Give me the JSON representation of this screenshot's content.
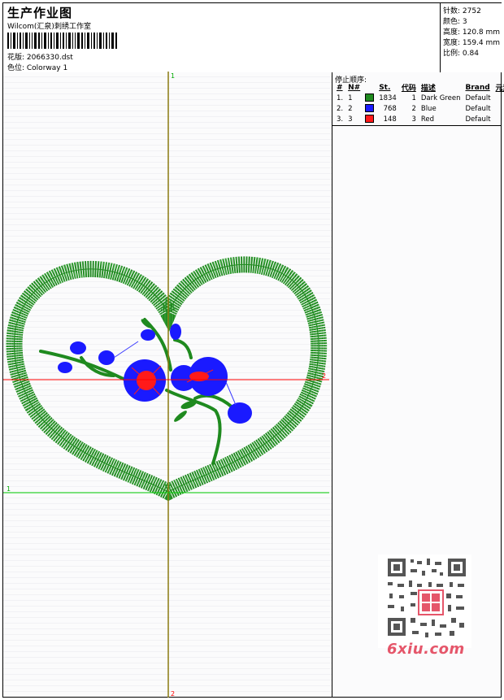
{
  "header": {
    "title": "生产作业图",
    "studio": "Wilcom(汇泉)刺绣工作室",
    "design_label": "花版: 2066330.dst",
    "colorway_label": "色位: Colorway 1"
  },
  "stats": {
    "stitches": "针数: 2752",
    "colors": "颜色: 3",
    "height": "高度: 120.8 mm",
    "width": "宽度: 159.4 mm",
    "scale": "比例: 0.84"
  },
  "stop_sequence": {
    "title": "停止顺序:",
    "headers": [
      "#",
      "N#",
      "St.",
      "代码",
      "描述",
      "Brand",
      "元素"
    ],
    "rows": [
      {
        "num": "1.",
        "n": "1",
        "color": "#1f8a1f",
        "stitches": "1834",
        "code": "1",
        "desc": "Dark Green",
        "brand": "Default"
      },
      {
        "num": "2.",
        "n": "2",
        "color": "#1a1aff",
        "stitches": "768",
        "code": "2",
        "desc": "Blue",
        "brand": "Default"
      },
      {
        "num": "3.",
        "n": "3",
        "color": "#ff1a1a",
        "stitches": "148",
        "code": "3",
        "desc": "Red",
        "brand": "Default"
      }
    ]
  },
  "guides": {
    "top_v": "1",
    "bottom_v": "2",
    "left_h": "1",
    "right_h": "2"
  },
  "watermark": {
    "brand": "6xiu.com"
  },
  "colors": {
    "green": "#1f8a1f",
    "blue": "#1a1aff",
    "red": "#ff1a1a",
    "v_guide": "#8a7a10",
    "h_guide_red": "#ff0000",
    "h_guide_green": "#00cc00"
  }
}
